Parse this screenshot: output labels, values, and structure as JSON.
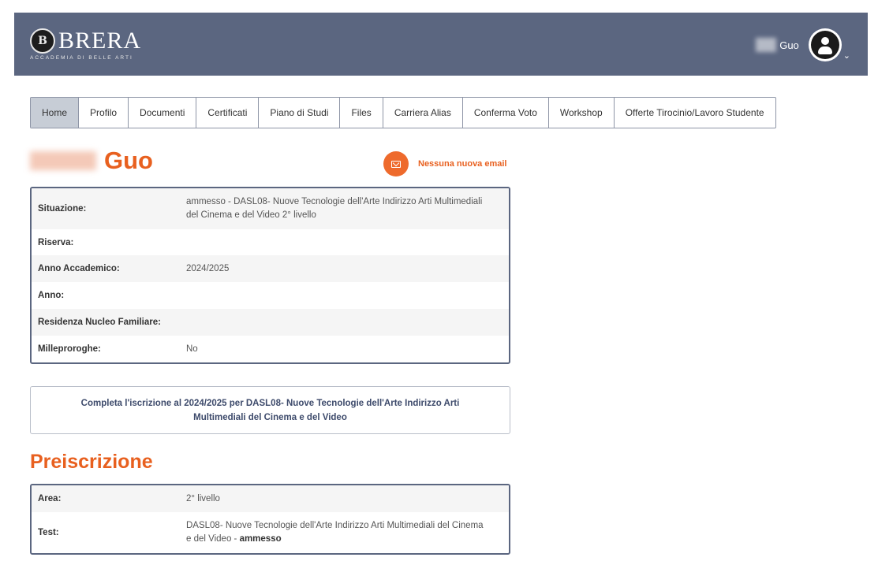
{
  "header": {
    "logo_mark": "B",
    "logo_text": "BRERA",
    "logo_subtitle": "ACCADEMIA DI BELLE ARTI",
    "user_name": "Guo",
    "colors": {
      "bar": "#5b6680",
      "accent": "#e8601f"
    }
  },
  "tabs": [
    {
      "label": "Home",
      "active": true
    },
    {
      "label": "Profilo"
    },
    {
      "label": "Documenti"
    },
    {
      "label": "Certificati"
    },
    {
      "label": "Piano di Studi"
    },
    {
      "label": "Files"
    },
    {
      "label": "Carriera Alias"
    },
    {
      "label": "Conferma Voto"
    },
    {
      "label": "Workshop"
    },
    {
      "label": "Offerte Tirocinio/Lavoro Studente"
    }
  ],
  "student": {
    "surname": "Guo"
  },
  "mail": {
    "icon": "mail-icon",
    "text": "Nessuna nuova email"
  },
  "situation": {
    "rows": [
      {
        "label": "Situazione:",
        "value": "ammesso - DASL08- Nuove Tecnologie dell'Arte Indirizzo Arti Multimediali del Cinema e del Video 2° livello"
      },
      {
        "label": "Riserva:",
        "value": ""
      },
      {
        "label": "Anno Accademico:",
        "value": "2024/2025"
      },
      {
        "label": "Anno:",
        "value": ""
      },
      {
        "label": "Residenza Nucleo Familiare:",
        "value": ""
      },
      {
        "label": "Milleproroghe:",
        "value": "No"
      }
    ]
  },
  "notice": {
    "text": "Completa l'iscrizione al 2024/2025 per DASL08- Nuove Tecnologie dell'Arte Indirizzo Arti Multimediali del Cinema e del Video"
  },
  "preiscrizione": {
    "title": "Preiscrizione",
    "rows": [
      {
        "label": "Area:",
        "value": "2° livello"
      },
      {
        "label": "Test:",
        "value": "DASL08- Nuove Tecnologie dell'Arte Indirizzo Arti Multimediali del Cinema e del Video - ",
        "value_bold": "ammesso"
      }
    ]
  }
}
